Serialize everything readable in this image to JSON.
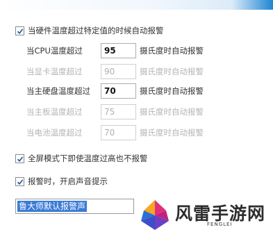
{
  "main_option": {
    "label": "当硬件温度超过特定值的时候自动报警",
    "checked": true
  },
  "thresholds": [
    {
      "label": "当CPU温度超过",
      "value": "95",
      "unit": "摄氏度时自动报警",
      "enabled": true
    },
    {
      "label": "当显卡温度超过",
      "value": "90",
      "unit": "摄氏度时自动报警",
      "enabled": false
    },
    {
      "label": "当主硬盘温度超过",
      "value": "70",
      "unit": "摄氏度时自动报警",
      "enabled": true
    },
    {
      "label": "当主板温度超过",
      "value": "75",
      "unit": "摄氏度时自动报警",
      "enabled": false
    },
    {
      "label": "当电池温度超过",
      "value": "70",
      "unit": "摄氏度时自动报警",
      "enabled": false
    }
  ],
  "fullscreen_option": {
    "label": "全屏模式下即使温度过高也不报警",
    "checked": true
  },
  "sound_option": {
    "label": "报警时，开启声音提示",
    "checked": true
  },
  "sound_select": {
    "value": "鲁大师默认报警声"
  },
  "watermark": {
    "text": "风雷手游网",
    "sub": "FENGLEI"
  },
  "colors": {
    "check": "#2a5ea6",
    "selection": "#3a7bd5",
    "logo_pink": "#e0307a",
    "logo_blue": "#2a6fd6",
    "logo_orange": "#f5a623"
  }
}
